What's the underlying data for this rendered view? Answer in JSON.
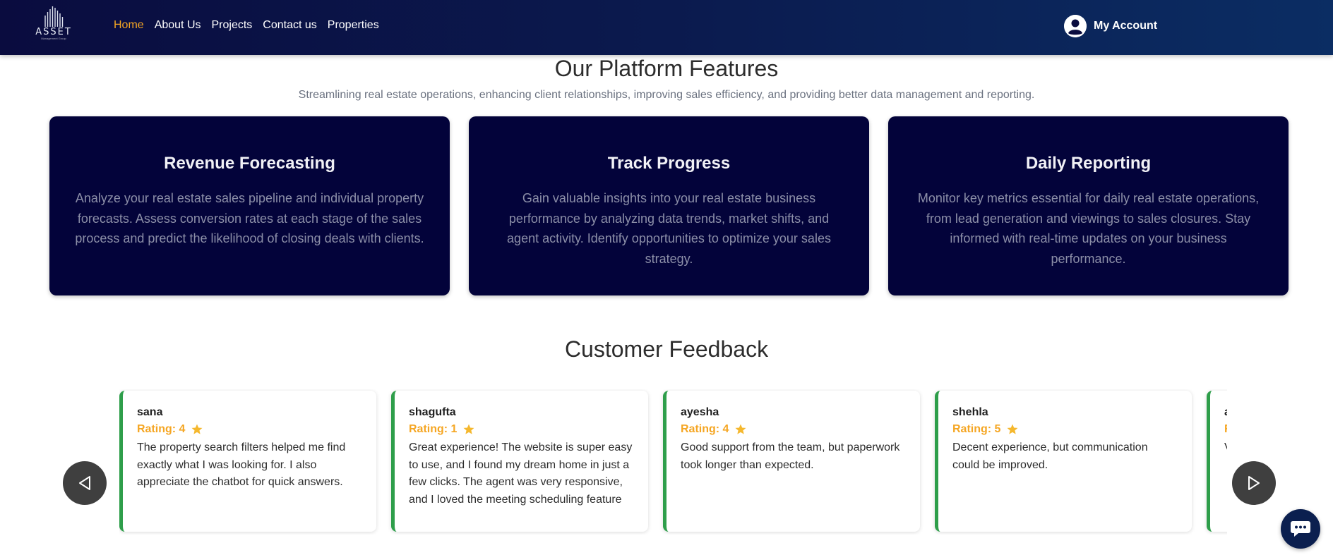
{
  "header": {
    "logo_text": "ASSET",
    "logo_subtext": "Management Group",
    "nav": [
      {
        "label": "Home",
        "active": true
      },
      {
        "label": "About Us"
      },
      {
        "label": "Projects"
      },
      {
        "label": "Contact us"
      },
      {
        "label": "Properties"
      }
    ],
    "account_label": "My Account"
  },
  "features": {
    "title": "Our Platform Features",
    "subtitle": "Streamlining real estate operations, enhancing client relationships, improving sales efficiency, and providing better data management and reporting.",
    "cards": [
      {
        "title": "Revenue Forecasting",
        "text": "Analyze your real estate sales pipeline and individual property forecasts. Assess conversion rates at each stage of the sales process and predict the likelihood of closing deals with clients."
      },
      {
        "title": "Track Progress",
        "text": "Gain valuable insights into your real estate business performance by analyzing data trends, market shifts, and agent activity. Identify opportunities to optimize your sales strategy."
      },
      {
        "title": "Daily Reporting",
        "text": "Monitor key metrics essential for daily real estate operations, from lead generation and viewings to sales closures. Stay informed with real-time updates on your business performance."
      }
    ]
  },
  "feedback": {
    "title": "Customer Feedback",
    "reviews": [
      {
        "name": "sana",
        "rating": "Rating: 4",
        "text": "The property search filters helped me find exactly what I was looking for. I also appreciate the chatbot for quick answers."
      },
      {
        "name": "shagufta",
        "rating": "Rating: 1",
        "text": "Great experience! The website is super easy to use, and I found my dream home in just a few clicks. The agent was very responsive, and I loved the meeting scheduling feature"
      },
      {
        "name": "ayesha",
        "rating": "Rating: 4",
        "text": "Good support from the team, but paperwork took longer than expected."
      },
      {
        "name": "shehla",
        "rating": "Rating: 5",
        "text": "Decent experience, but communication could be improved."
      },
      {
        "name": "a",
        "rating": "R",
        "text": "V b"
      }
    ],
    "prev_icon": "triangle-left-icon",
    "next_icon": "triangle-right-icon"
  },
  "colors": {
    "header_start": "#0a0c3f",
    "header_end": "#0b2d63",
    "card_bg": "#03033a",
    "accent": "#f5a623",
    "review_border": "#2e9e4a",
    "chat_bg": "#0b1f4f"
  },
  "icons": {
    "account": "user-circle-icon",
    "chat": "chat-bubble-icon",
    "star": "star-icon"
  }
}
